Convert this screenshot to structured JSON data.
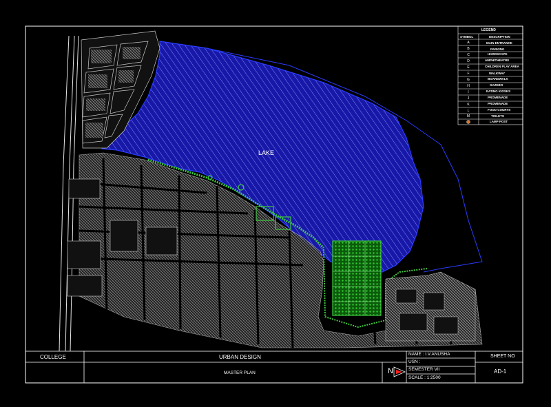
{
  "lake_label": "LAKE",
  "legend": {
    "title": "LEGEND",
    "col_symbol": "SYMBOL",
    "col_description": "DESCRIPTION",
    "rows": [
      {
        "symbol": "A",
        "description": "MAIN ENTRANCE"
      },
      {
        "symbol": "B",
        "description": "PARKING"
      },
      {
        "symbol": "C",
        "description": "HARDSCAPE"
      },
      {
        "symbol": "D",
        "description": "AMPHITHEATRE"
      },
      {
        "symbol": "E",
        "description": "CHILDREN PLAY AREA"
      },
      {
        "symbol": "F",
        "description": "WALKWAY"
      },
      {
        "symbol": "G",
        "description": "BOARDWALK"
      },
      {
        "symbol": "H",
        "description": "GAZEBO"
      },
      {
        "symbol": "I",
        "description": "EATING KIOSKS"
      },
      {
        "symbol": "J",
        "description": "PROMENADE"
      },
      {
        "symbol": "K",
        "description": "PROMENADE"
      },
      {
        "symbol": "L",
        "description": "FOOD COURTS"
      },
      {
        "symbol": "M",
        "description": "TOILETS"
      },
      {
        "symbol": "",
        "description": "LAMP POST"
      }
    ]
  },
  "title_block": {
    "college": "COLLEGE",
    "subject": "URBAN DESIGN",
    "drawing_title": "MASTER PLAN",
    "name": "NAME : I.V.ANUSHA",
    "usn": "USN :",
    "semester": "SEMESTER VII",
    "scale": "SCALE : 1:2500",
    "sheet_no_label": "SHEET NO",
    "sheet_no": "AD-1",
    "north_label": "N"
  },
  "colors": {
    "background": "#000000",
    "lake_outline": "#2a3cff",
    "lake_fill": "#1a1aa0",
    "lake_hatch": "#9aa0ff",
    "buildings": "#c8c8c8",
    "greenery": "#3ec83e",
    "frame": "#ffffff",
    "lamp_symbol": "#e07020"
  }
}
